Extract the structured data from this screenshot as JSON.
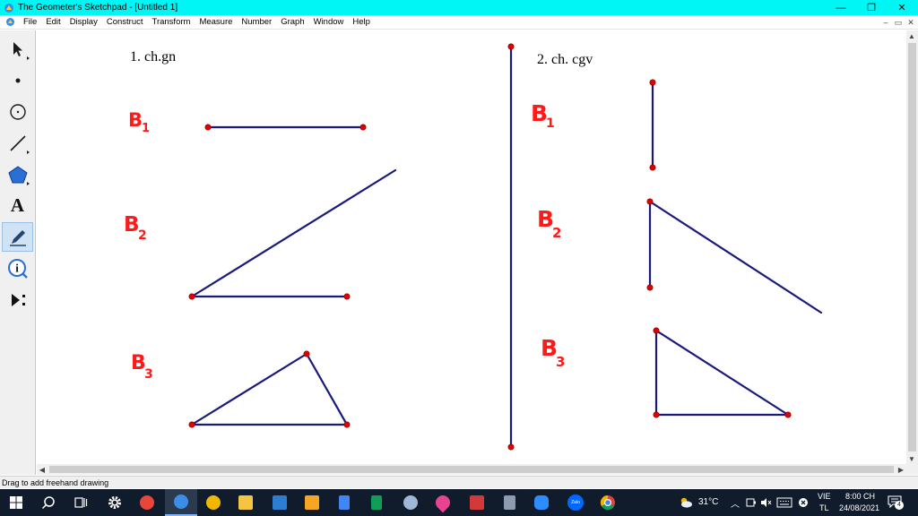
{
  "window": {
    "title": "The Geometer's Sketchpad - [Untitled 1]",
    "min_symbol": "—",
    "restore_symbol": "❐",
    "close_symbol": "✕"
  },
  "menu": {
    "items": [
      "File",
      "Edit",
      "Display",
      "Construct",
      "Transform",
      "Measure",
      "Number",
      "Graph",
      "Window",
      "Help"
    ],
    "mdi_min": "–",
    "mdi_restore": "▭",
    "mdi_close": "✕"
  },
  "toolbox": {
    "tools": [
      {
        "name": "arrow-tool-icon",
        "active": false
      },
      {
        "name": "point-tool-icon",
        "active": false
      },
      {
        "name": "compass-tool-icon",
        "active": false
      },
      {
        "name": "straightedge-tool-icon",
        "active": false
      },
      {
        "name": "polygon-tool-icon",
        "active": false
      },
      {
        "name": "text-tool-icon",
        "active": false,
        "glyph": "A"
      },
      {
        "name": "marker-tool-icon",
        "active": true
      },
      {
        "name": "information-tool-icon",
        "active": false,
        "glyph": "i"
      },
      {
        "name": "custom-tool-icon",
        "active": false
      }
    ]
  },
  "sketch": {
    "heading_left": "1. ch.gn",
    "heading_right": "2. ch. cgv",
    "handwritten_labels": [
      {
        "text": "B",
        "sub": "1"
      },
      {
        "text": "B",
        "sub": "2"
      },
      {
        "text": "B",
        "sub": "3"
      },
      {
        "text": "B",
        "sub": "1"
      },
      {
        "text": "B",
        "sub": "2"
      },
      {
        "text": "B",
        "sub": "3"
      }
    ],
    "line_color": "#1a1a7a",
    "point_color": "#e00000",
    "ink_color": "#ff1a1a"
  },
  "status": {
    "text": "Drag to add freehand drawing"
  },
  "taskbar": {
    "apps": [
      {
        "name": "windows-start-icon",
        "color": "#ffffff"
      },
      {
        "name": "search-icon",
        "color": "#ffffff"
      },
      {
        "name": "task-view-icon",
        "color": "#ffffff"
      },
      {
        "name": "settings-gear-icon",
        "color": "#ffffff"
      },
      {
        "name": "paint-app-icon",
        "color": "#e8463a"
      },
      {
        "name": "sketchpad-app-icon",
        "color": "#3a8ee6",
        "active": true
      },
      {
        "name": "weather-app-icon",
        "color": "#f2b705"
      },
      {
        "name": "file-explorer-icon",
        "color": "#f4c542"
      },
      {
        "name": "photos-app-icon",
        "color": "#2d7dd2"
      },
      {
        "name": "sticky-app-icon",
        "color": "#f5a623"
      },
      {
        "name": "docs-app-icon",
        "color": "#4285f4"
      },
      {
        "name": "sheets-app-icon",
        "color": "#0f9d58"
      },
      {
        "name": "geogebra-app-icon",
        "color": "#9fb8d6"
      },
      {
        "name": "drop-app-icon",
        "color": "#e84393"
      },
      {
        "name": "chart-app-icon",
        "color": "#d23a3a"
      },
      {
        "name": "calculator-app-icon",
        "color": "#8e9aaf"
      },
      {
        "name": "zoom-app-icon",
        "color": "#2d8cff"
      },
      {
        "name": "zalo-app-icon",
        "color": "#0068ff",
        "label": "Zalo"
      },
      {
        "name": "chrome-app-icon",
        "color": "#db4437"
      }
    ],
    "temperature": "31°C",
    "lang_top": "VIE",
    "lang_bottom": "TL",
    "time": "8:00 CH",
    "date": "24/08/2021",
    "notification_count": "4"
  }
}
